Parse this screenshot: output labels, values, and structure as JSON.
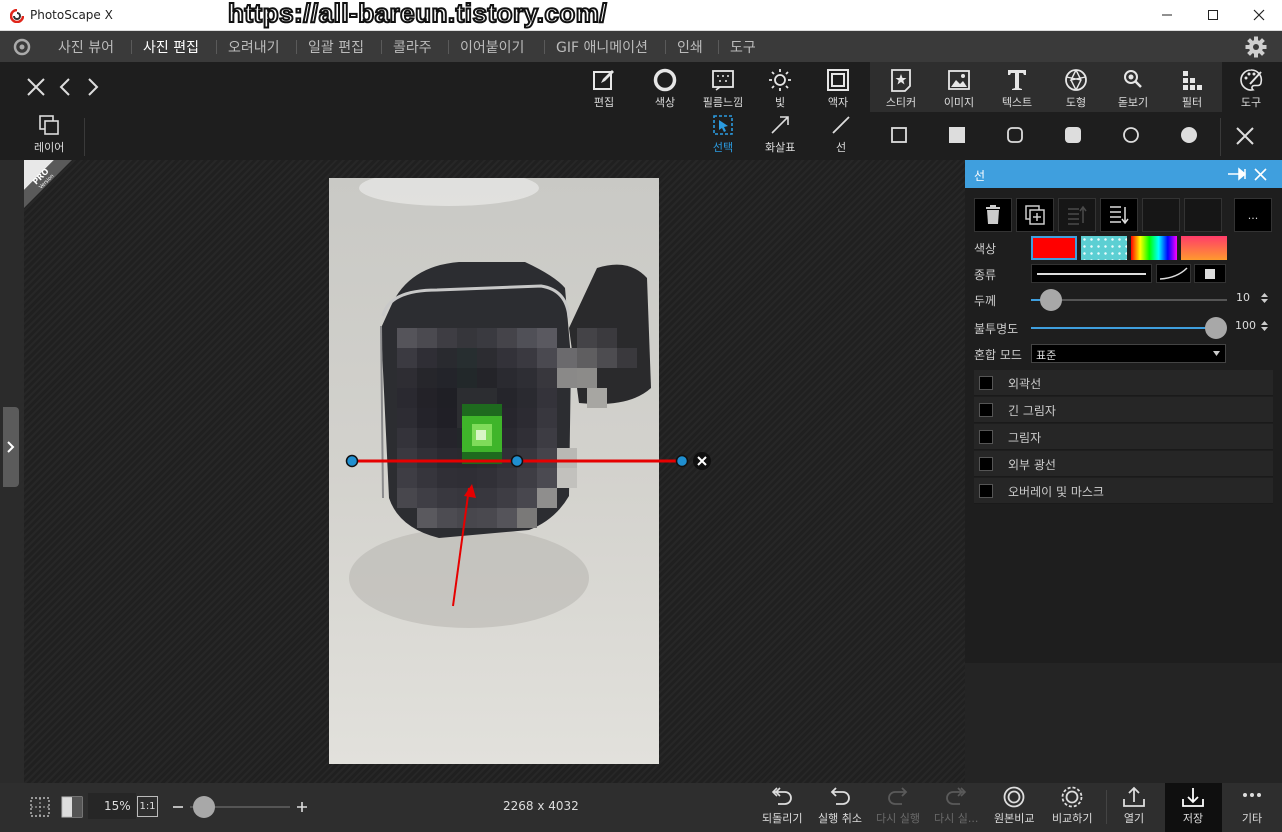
{
  "window": {
    "title": "PhotoScape X",
    "watermark": "https://all-bareun.tistory.com/"
  },
  "menu": {
    "items": [
      "사진 뷰어",
      "사진 편집",
      "오려내기",
      "일괄 편집",
      "콜라주",
      "이어붙이기",
      "GIF 애니메이션",
      "인쇄",
      "도구"
    ],
    "active": "사진 편집"
  },
  "tools": {
    "edit": "편집",
    "color": "색상",
    "film": "필름느낌",
    "light": "빛",
    "frame": "액자",
    "sticker": "스티커",
    "image": "이미지",
    "text": "텍스트",
    "shape": "도형",
    "magnifier": "돋보기",
    "filter": "필터",
    "tools": "도구"
  },
  "subtools": {
    "layer": "레이어",
    "select": "선택",
    "arrow": "화살표",
    "line": "선"
  },
  "badge": {
    "line1": "PRO",
    "line2": "Version"
  },
  "panel": {
    "title": "선",
    "more_label": "...",
    "color_label": "색상",
    "type_label": "종류",
    "thickness_label": "두께",
    "thickness_value": 10,
    "thickness_max": 100,
    "opacity_label": "불투명도",
    "opacity_value": 100,
    "opacity_max": 100,
    "blend_label": "혼합 모드",
    "blend_value": "표준",
    "options": [
      "외곽선",
      "긴 그림자",
      "그림자",
      "외부 광선",
      "오버레이 및 마스크"
    ]
  },
  "colors": {
    "accent": "#3f9fde",
    "line_red": "#e60000",
    "handle": "#1f8fd0"
  },
  "bottom": {
    "zoom": "15%",
    "one_to_one": "1:1",
    "dimensions": "2268 x 4032",
    "revert": "되돌리기",
    "undo": "실행 취소",
    "redo": "다시 실행",
    "redo_all": "다시 실...",
    "compare_original": "원본비교",
    "compare": "비교하기",
    "open": "열기",
    "save": "저장",
    "more": "기타"
  }
}
